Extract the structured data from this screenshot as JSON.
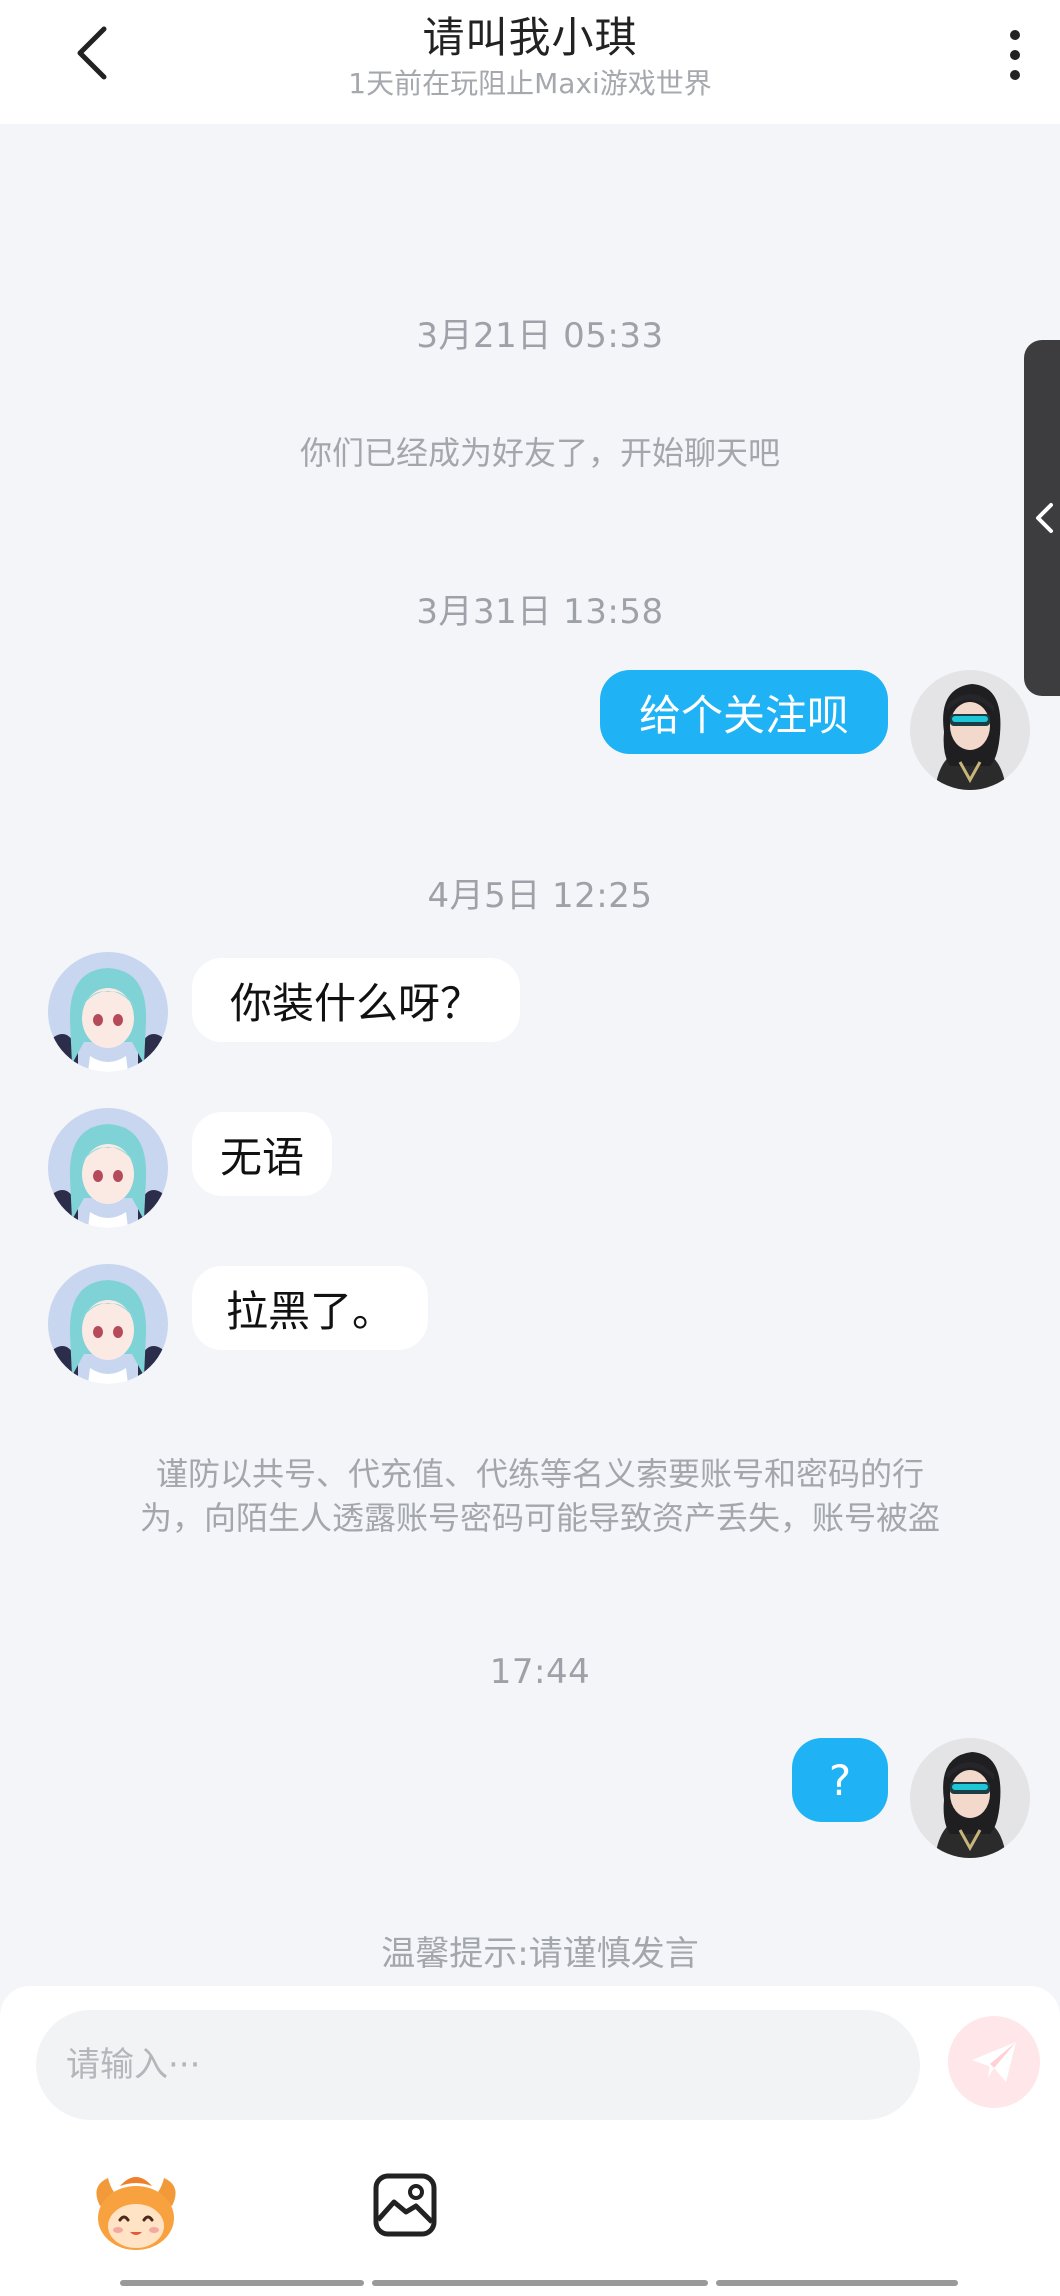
{
  "header": {
    "title": "请叫我小琪",
    "subtitle": "1天前在玩阻止Maxi游戏世界"
  },
  "messages": {
    "time_1": "3月21日 05:33",
    "friend_notice": "你们已经成为好友了，开始聊天吧",
    "time_2": "3月31日 13:58",
    "msg_1": "给个关注呗",
    "time_3": "4月5日 12:25",
    "msg_2": "你装什么呀？",
    "msg_3": "无语",
    "msg_4": "拉黑了。",
    "warning_line_1": "谨防以共号、代充值、代练等名义索要账号和密码的行",
    "warning_line_2": "为，向陌生人透露账号密码可能导致资产丢失，账号被盗",
    "time_4": "17:44",
    "msg_5": "?"
  },
  "tip": "温馨提示:请谨慎发言",
  "composer": {
    "placeholder": "请输入···"
  },
  "colors": {
    "accent": "#1fb2f5",
    "background": "#f3f5f9",
    "send_button": "#ffe6e8"
  },
  "icons": [
    "back-arrow-icon",
    "more-vertical-icon",
    "chevron-left-icon",
    "send-icon",
    "mascot-icon",
    "image-icon"
  ]
}
